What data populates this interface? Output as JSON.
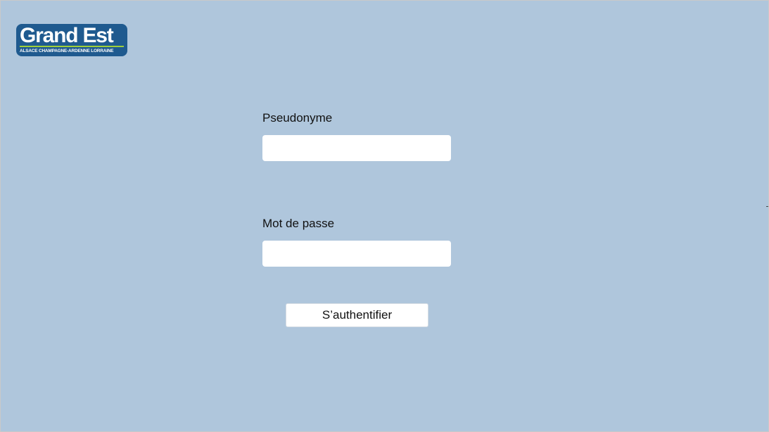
{
  "logo": {
    "main": "Grand Est",
    "sub": "ALSACE CHAMPAGNE-ARDENNE LORRAINE",
    "colors": {
      "background": "#1f5a8f",
      "accent_line": "#9fcf3a"
    }
  },
  "form": {
    "username_label": "Pseudonyme",
    "username_value": "",
    "password_label": "Mot de passe",
    "password_value": "",
    "submit_label": "S’authentifier"
  },
  "colors": {
    "page_background": "#afc6dc",
    "input_background": "#ffffff"
  }
}
